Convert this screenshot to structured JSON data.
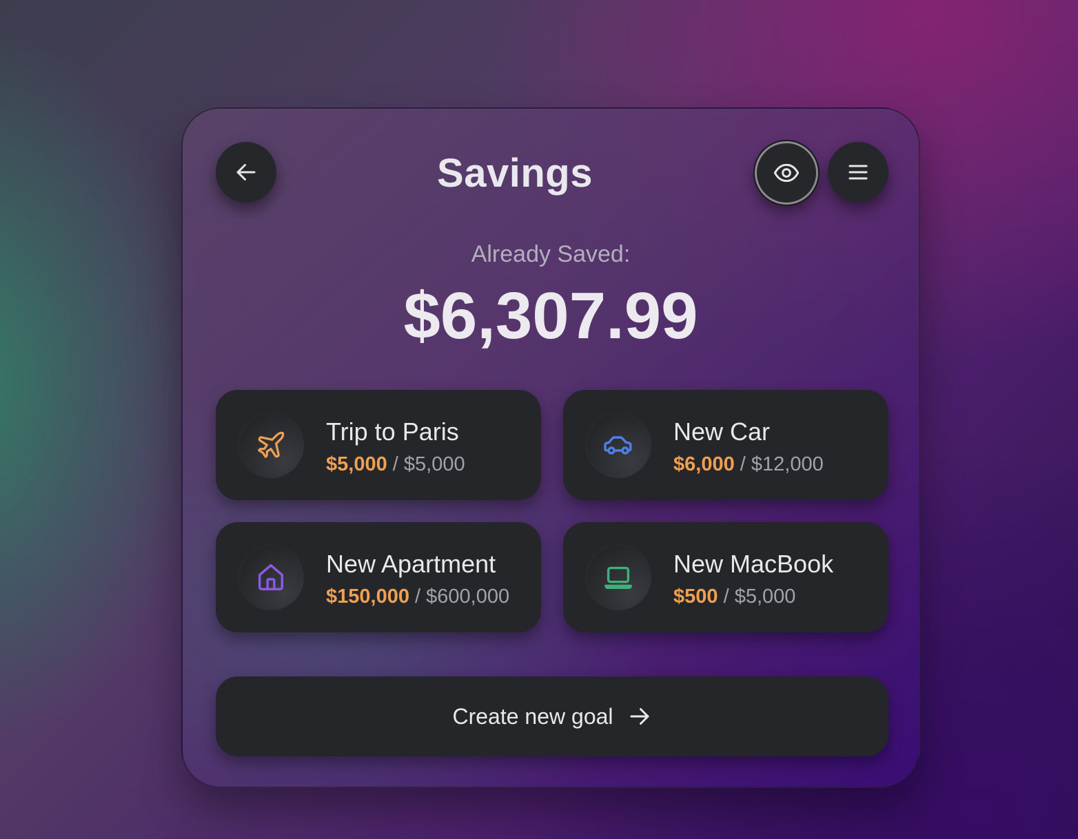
{
  "header": {
    "title": "Savings",
    "back_icon": "arrow-left-icon",
    "visibility_icon": "eye-icon",
    "menu_icon": "menu-icon"
  },
  "summary": {
    "label": "Already Saved:",
    "amount": "$6,307.99"
  },
  "goals": [
    {
      "name": "Trip to Paris",
      "saved": "$5,000",
      "separator": "/",
      "target": "$5,000",
      "icon": "airplane-icon",
      "icon_color": "#f0a050"
    },
    {
      "name": "New Car",
      "saved": "$6,000",
      "separator": "/",
      "target": "$12,000",
      "icon": "car-icon",
      "icon_color": "#4f7fe8"
    },
    {
      "name": "New Apartment",
      "saved": "$150,000",
      "separator": "/",
      "target": "$600,000",
      "icon": "house-icon",
      "icon_color": "#8a5be0"
    },
    {
      "name": "New MacBook",
      "saved": "$500",
      "separator": "/",
      "target": "$5,000",
      "icon": "laptop-icon",
      "icon_color": "#3fb07a"
    }
  ],
  "actions": {
    "create_label": "Create new goal",
    "create_icon": "arrow-right-icon"
  },
  "colors": {
    "saved_accent": "#f0a050",
    "card_background": "#25262a"
  }
}
